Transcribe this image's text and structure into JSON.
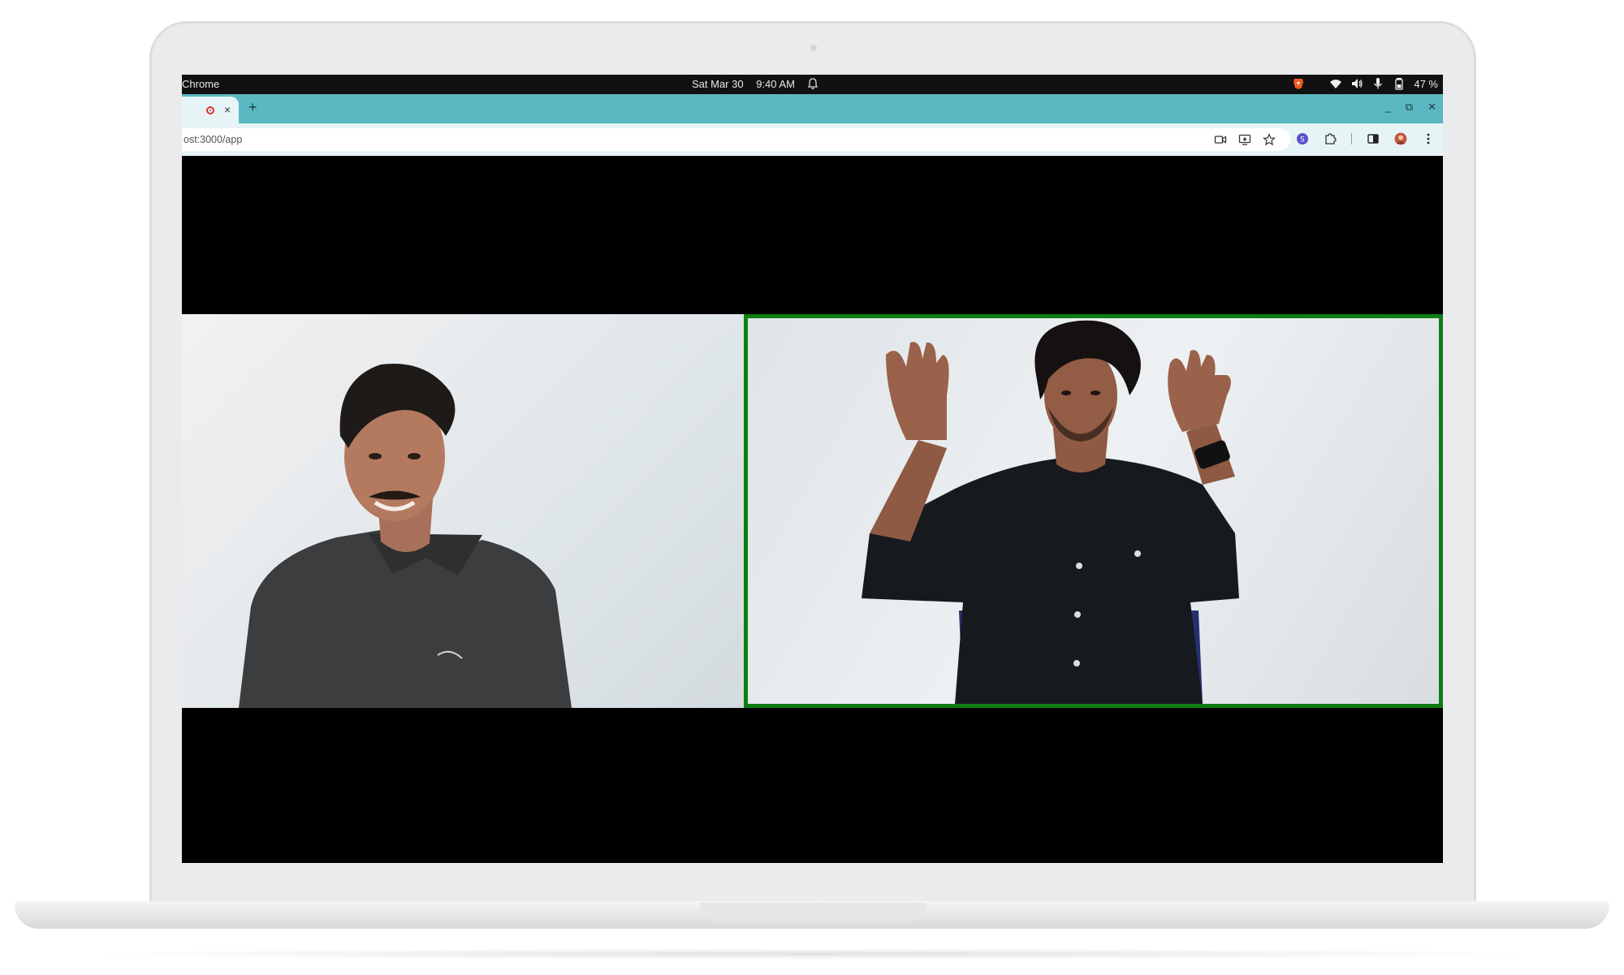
{
  "system_bar": {
    "app_name": "Chrome",
    "date": "Sat Mar 30",
    "time": "9:40 AM",
    "battery": "47 %",
    "icons": [
      "bell-icon",
      "brave-icon",
      "wifi-icon",
      "volume-icon",
      "mic-icon",
      "battery-icon"
    ]
  },
  "browser": {
    "tabs": [
      {
        "status_icon": "recording-icon",
        "close": "×"
      }
    ],
    "new_tab": "+",
    "window_controls": [
      "minimize-icon",
      "restore-icon",
      "close-icon"
    ],
    "window_glyphs": {
      "minimize": "_",
      "restore": "⧉",
      "close": "✕"
    },
    "url": "ost:3000/app",
    "url_icons": [
      "camera-icon",
      "cast-icon",
      "star-icon"
    ],
    "toolbar_icons": [
      "extension-s-icon",
      "puzzle-icon",
      "sidepanel-icon",
      "profile-avatar",
      "kebab-menu-icon"
    ]
  },
  "call": {
    "participants": [
      {
        "position": "left",
        "highlighted": false
      },
      {
        "position": "right",
        "highlighted": true,
        "highlight_color": "#0e7d14"
      }
    ]
  }
}
